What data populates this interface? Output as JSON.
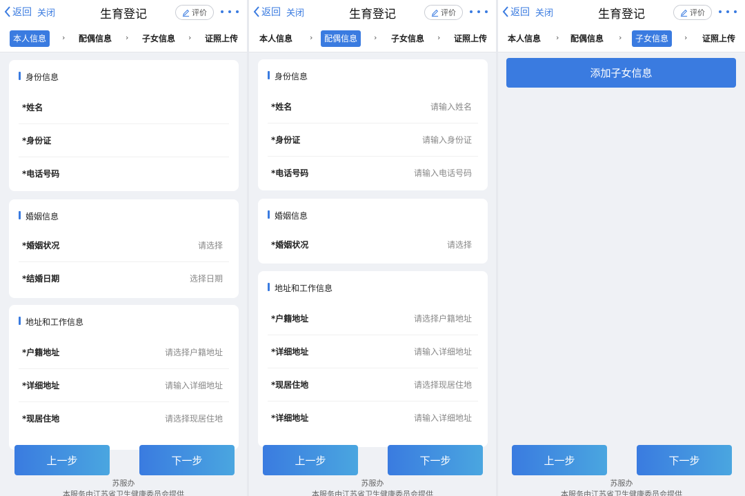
{
  "header": {
    "back": "返回",
    "close": "关闭",
    "title": "生育登记",
    "rate": "评价"
  },
  "steps": [
    "本人信息",
    "配偶信息",
    "子女信息",
    "证照上传"
  ],
  "sections": {
    "identity": "身份信息",
    "marriage": "婚姻信息",
    "address": "地址和工作信息"
  },
  "fields": {
    "name": {
      "label": "*姓名",
      "placeholder": "请输入姓名"
    },
    "id_card": {
      "label": "*身份证",
      "placeholder": "请输入身份证"
    },
    "phone": {
      "label": "*电话号码",
      "placeholder": "请输入电话号码"
    },
    "marital_status": {
      "label": "*婚姻状况",
      "placeholder": "请选择"
    },
    "marriage_date": {
      "label": "*结婚日期",
      "placeholder": "选择日期"
    },
    "household_address": {
      "label": "*户籍地址",
      "placeholder": "请选择户籍地址"
    },
    "detail_address": {
      "label": "*详细地址",
      "placeholder": "请输入详细地址"
    },
    "current_address": {
      "label": "*现居住地",
      "placeholder": "请选择现居住地"
    }
  },
  "buttons": {
    "prev": "上一步",
    "next": "下一步",
    "add_child": "添加子女信息"
  },
  "footer": {
    "provider": "苏服办",
    "note": "本服务由江苏省卫生健康委员会提供"
  },
  "colors": {
    "accent": "#3a7be0",
    "page_bg": "#eff1f5"
  }
}
